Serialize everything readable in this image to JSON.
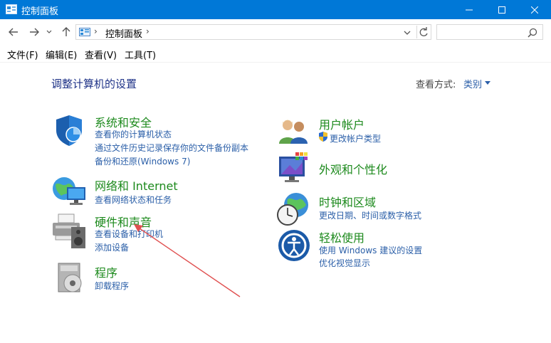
{
  "window": {
    "title": "控制面板",
    "minimize_icon": "minimize-icon",
    "maximize_icon": "maximize-icon",
    "close_icon": "close-icon"
  },
  "address_bar": {
    "breadcrumb": "控制面板",
    "search_placeholder": ""
  },
  "menu": {
    "items": [
      "文件(F)",
      "编辑(E)",
      "查看(V)",
      "工具(T)"
    ]
  },
  "content": {
    "heading": "调整计算机的设置",
    "view_by_label": "查看方式:",
    "view_by_value": "类别"
  },
  "categories": [
    {
      "title": "系统和安全",
      "icon": "shield-icon",
      "links": [
        "查看你的计算机状态",
        "通过文件历史记录保存你的文件备份副本",
        "备份和还原(Windows 7)"
      ]
    },
    {
      "title": "网络和 Internet",
      "icon": "network-globe-icon",
      "links": [
        "查看网络状态和任务"
      ]
    },
    {
      "title": "硬件和声音",
      "icon": "printer-speaker-icon",
      "links": [
        "查看设备和打印机",
        "添加设备"
      ]
    },
    {
      "title": "程序",
      "icon": "programs-disc-icon",
      "links": [
        "卸载程序"
      ]
    },
    {
      "title": "用户帐户",
      "icon": "users-icon",
      "links": [
        "更改帐户类型"
      ]
    },
    {
      "title": "外观和个性化",
      "icon": "monitor-palette-icon",
      "links": []
    },
    {
      "title": "时钟和区域",
      "icon": "clock-globe-icon",
      "links": [
        "更改日期、时间或数字格式"
      ]
    },
    {
      "title": "轻松使用",
      "icon": "ease-of-access-icon",
      "links": [
        "使用 Windows 建议的设置",
        "优化视觉显示"
      ]
    }
  ],
  "colors": {
    "titlebar": "#0078d7",
    "category_title": "#1d8a1d",
    "link": "#2b5fa8",
    "heading": "#1e3287",
    "annotation_arrow": "#e05050"
  }
}
